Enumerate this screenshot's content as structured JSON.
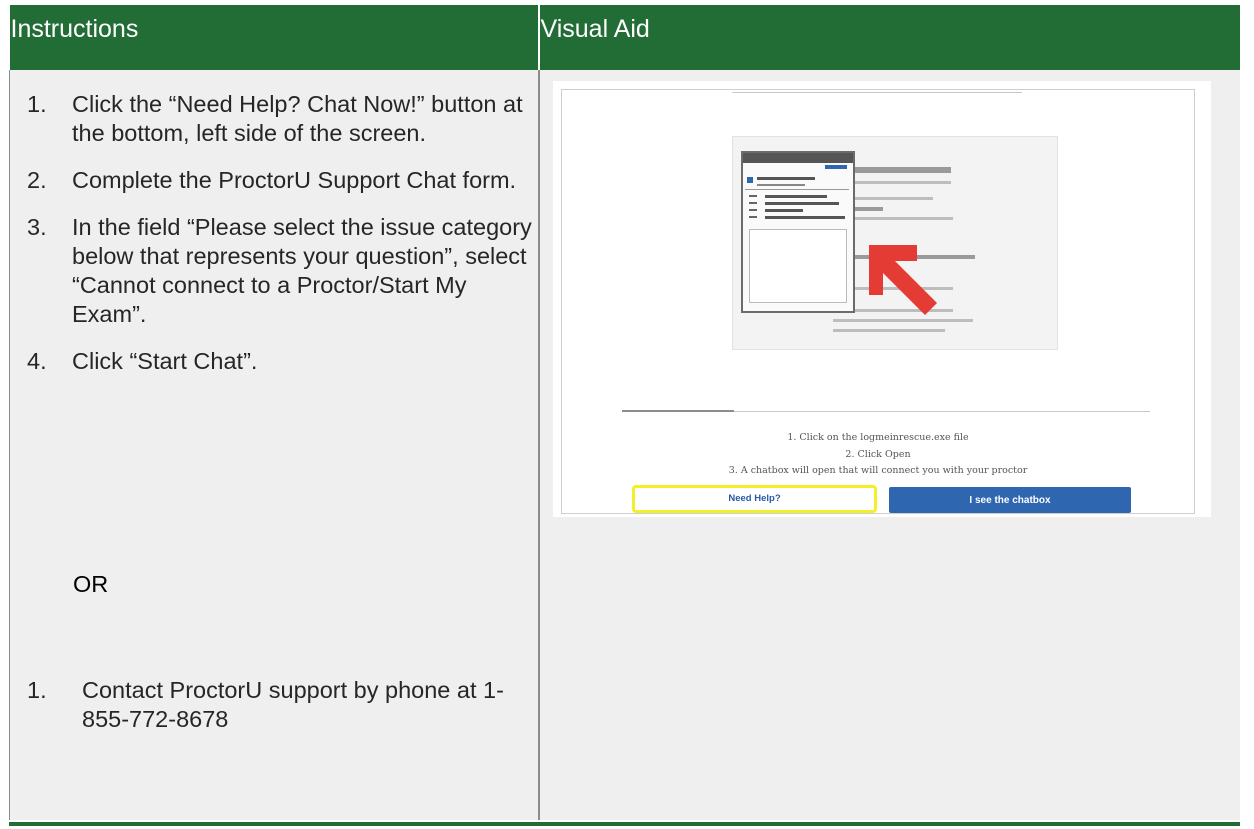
{
  "header": {
    "col_instructions": "Instructions",
    "col_visual_aid": "Visual Aid"
  },
  "steps": [
    {
      "num": "1.",
      "text": "Click the “Need Help? Chat Now!” button at the bottom, left side of the screen."
    },
    {
      "num": "2.",
      "text": "Complete the ProctorU Support Chat form."
    },
    {
      "num": "3.",
      "text": "In the field “Please select the issue category below that represents your question”, select “Cannot connect to a Proctor/Start My Exam”."
    },
    {
      "num": "4.",
      "text": "Click “Start Chat”."
    }
  ],
  "or_label": "OR",
  "alt_step": {
    "num": "1.",
    "text": "Contact ProctorU support by phone at 1-855-772-8678"
  },
  "visual_aid": {
    "captions": [
      "1. Click on the logmeinrescue.exe file",
      "2. Click Open",
      "3. A chatbox will open that will connect you with your proctor"
    ],
    "help_button": "Need Help?",
    "chatbox_button": "I see the chatbox",
    "highlight_color": "#f5ef2a",
    "arrow_color": "#e53b35",
    "button_color": "#2f66b0"
  },
  "colors": {
    "header_green": "#226d35",
    "cell_gray": "#efefef"
  }
}
